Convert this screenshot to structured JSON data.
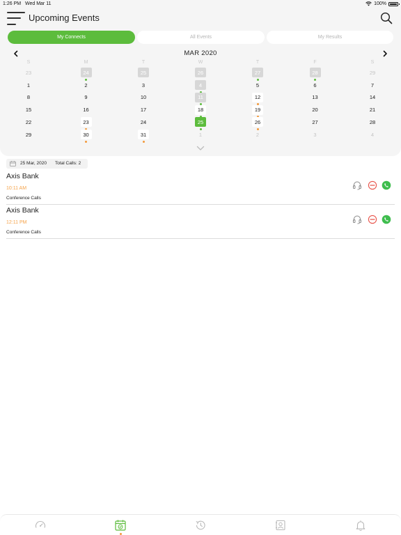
{
  "status_bar": {
    "time": "1:26 PM",
    "date": "Wed Mar 11",
    "battery": "100%"
  },
  "header": {
    "title": "Upcoming Events",
    "menu_icon": "hamburger-menu-icon",
    "search_icon": "search-icon"
  },
  "tabs": [
    {
      "label": "My Connects",
      "active": true
    },
    {
      "label": "All Events",
      "active": false
    },
    {
      "label": "My Results",
      "active": false
    }
  ],
  "calendar": {
    "month_label": "MAR 2020",
    "weekdays": [
      "S",
      "M",
      "T",
      "W",
      "T",
      "F",
      "S"
    ],
    "weeks": [
      [
        {
          "label": "23",
          "state": "muted"
        },
        {
          "label": "24",
          "state": "shaded",
          "dot": "green"
        },
        {
          "label": "25",
          "state": "shaded"
        },
        {
          "label": "26",
          "state": "shaded"
        },
        {
          "label": "27",
          "state": "shaded",
          "dot": "green"
        },
        {
          "label": "28",
          "state": "shaded",
          "dot": "green"
        },
        {
          "label": "29",
          "state": "muted"
        }
      ],
      [
        {
          "label": "1",
          "state": "normal"
        },
        {
          "label": "2",
          "state": "normal"
        },
        {
          "label": "3",
          "state": "normal"
        },
        {
          "label": "4",
          "state": "shaded",
          "dot": "green"
        },
        {
          "label": "5",
          "state": "normal"
        },
        {
          "label": "6",
          "state": "normal"
        },
        {
          "label": "7",
          "state": "normal"
        }
      ],
      [
        {
          "label": "8",
          "state": "normal"
        },
        {
          "label": "9",
          "state": "normal"
        },
        {
          "label": "10",
          "state": "normal"
        },
        {
          "label": "11",
          "state": "shaded",
          "dot": "green"
        },
        {
          "label": "12",
          "state": "highlight",
          "dot": "orange"
        },
        {
          "label": "13",
          "state": "normal"
        },
        {
          "label": "14",
          "state": "normal"
        }
      ],
      [
        {
          "label": "15",
          "state": "normal"
        },
        {
          "label": "16",
          "state": "normal"
        },
        {
          "label": "17",
          "state": "normal"
        },
        {
          "label": "18",
          "state": "highlight",
          "dot": "green"
        },
        {
          "label": "19",
          "state": "highlight",
          "dot": "orange"
        },
        {
          "label": "20",
          "state": "normal"
        },
        {
          "label": "21",
          "state": "normal"
        }
      ],
      [
        {
          "label": "22",
          "state": "normal"
        },
        {
          "label": "23",
          "state": "highlight",
          "dot": "orange"
        },
        {
          "label": "24",
          "state": "normal"
        },
        {
          "label": "25",
          "state": "selected",
          "dot": "green"
        },
        {
          "label": "26",
          "state": "highlight",
          "dot": "orange"
        },
        {
          "label": "27",
          "state": "normal"
        },
        {
          "label": "28",
          "state": "normal"
        }
      ],
      [
        {
          "label": "29",
          "state": "normal"
        },
        {
          "label": "30",
          "state": "highlight",
          "dot": "orange"
        },
        {
          "label": "31",
          "state": "highlight",
          "dot": "orange"
        },
        {
          "label": "1",
          "state": "muted"
        },
        {
          "label": "2",
          "state": "muted"
        },
        {
          "label": "3",
          "state": "muted"
        },
        {
          "label": "4",
          "state": "muted"
        }
      ]
    ],
    "prev_icon": "chevron-left-icon",
    "next_icon": "chevron-right-icon",
    "expand_icon": "chevron-down-icon"
  },
  "summary": {
    "date": "25 Mar, 2020",
    "total_calls": "Total Calls:  2",
    "icon": "calendar-icon"
  },
  "events": [
    {
      "title": "Axis Bank",
      "time": "10:11 AM",
      "type": "Conference Calls"
    },
    {
      "title": "Axis Bank",
      "time": "12:11 PM",
      "type": "Conference Calls"
    }
  ],
  "event_action_icons": [
    "headset-icon",
    "remove-icon",
    "whatsapp-icon"
  ],
  "bottom_nav": [
    {
      "icon": "dashboard-gauge-icon",
      "active": false
    },
    {
      "icon": "calendar-check-icon",
      "active": true
    },
    {
      "icon": "history-icon",
      "active": false
    },
    {
      "icon": "contacts-book-icon",
      "active": false
    },
    {
      "icon": "bell-icon",
      "active": false
    }
  ],
  "colors": {
    "accent_green": "#5cbc3c",
    "accent_orange": "#f39a3b",
    "remove_red": "#e8534a"
  }
}
